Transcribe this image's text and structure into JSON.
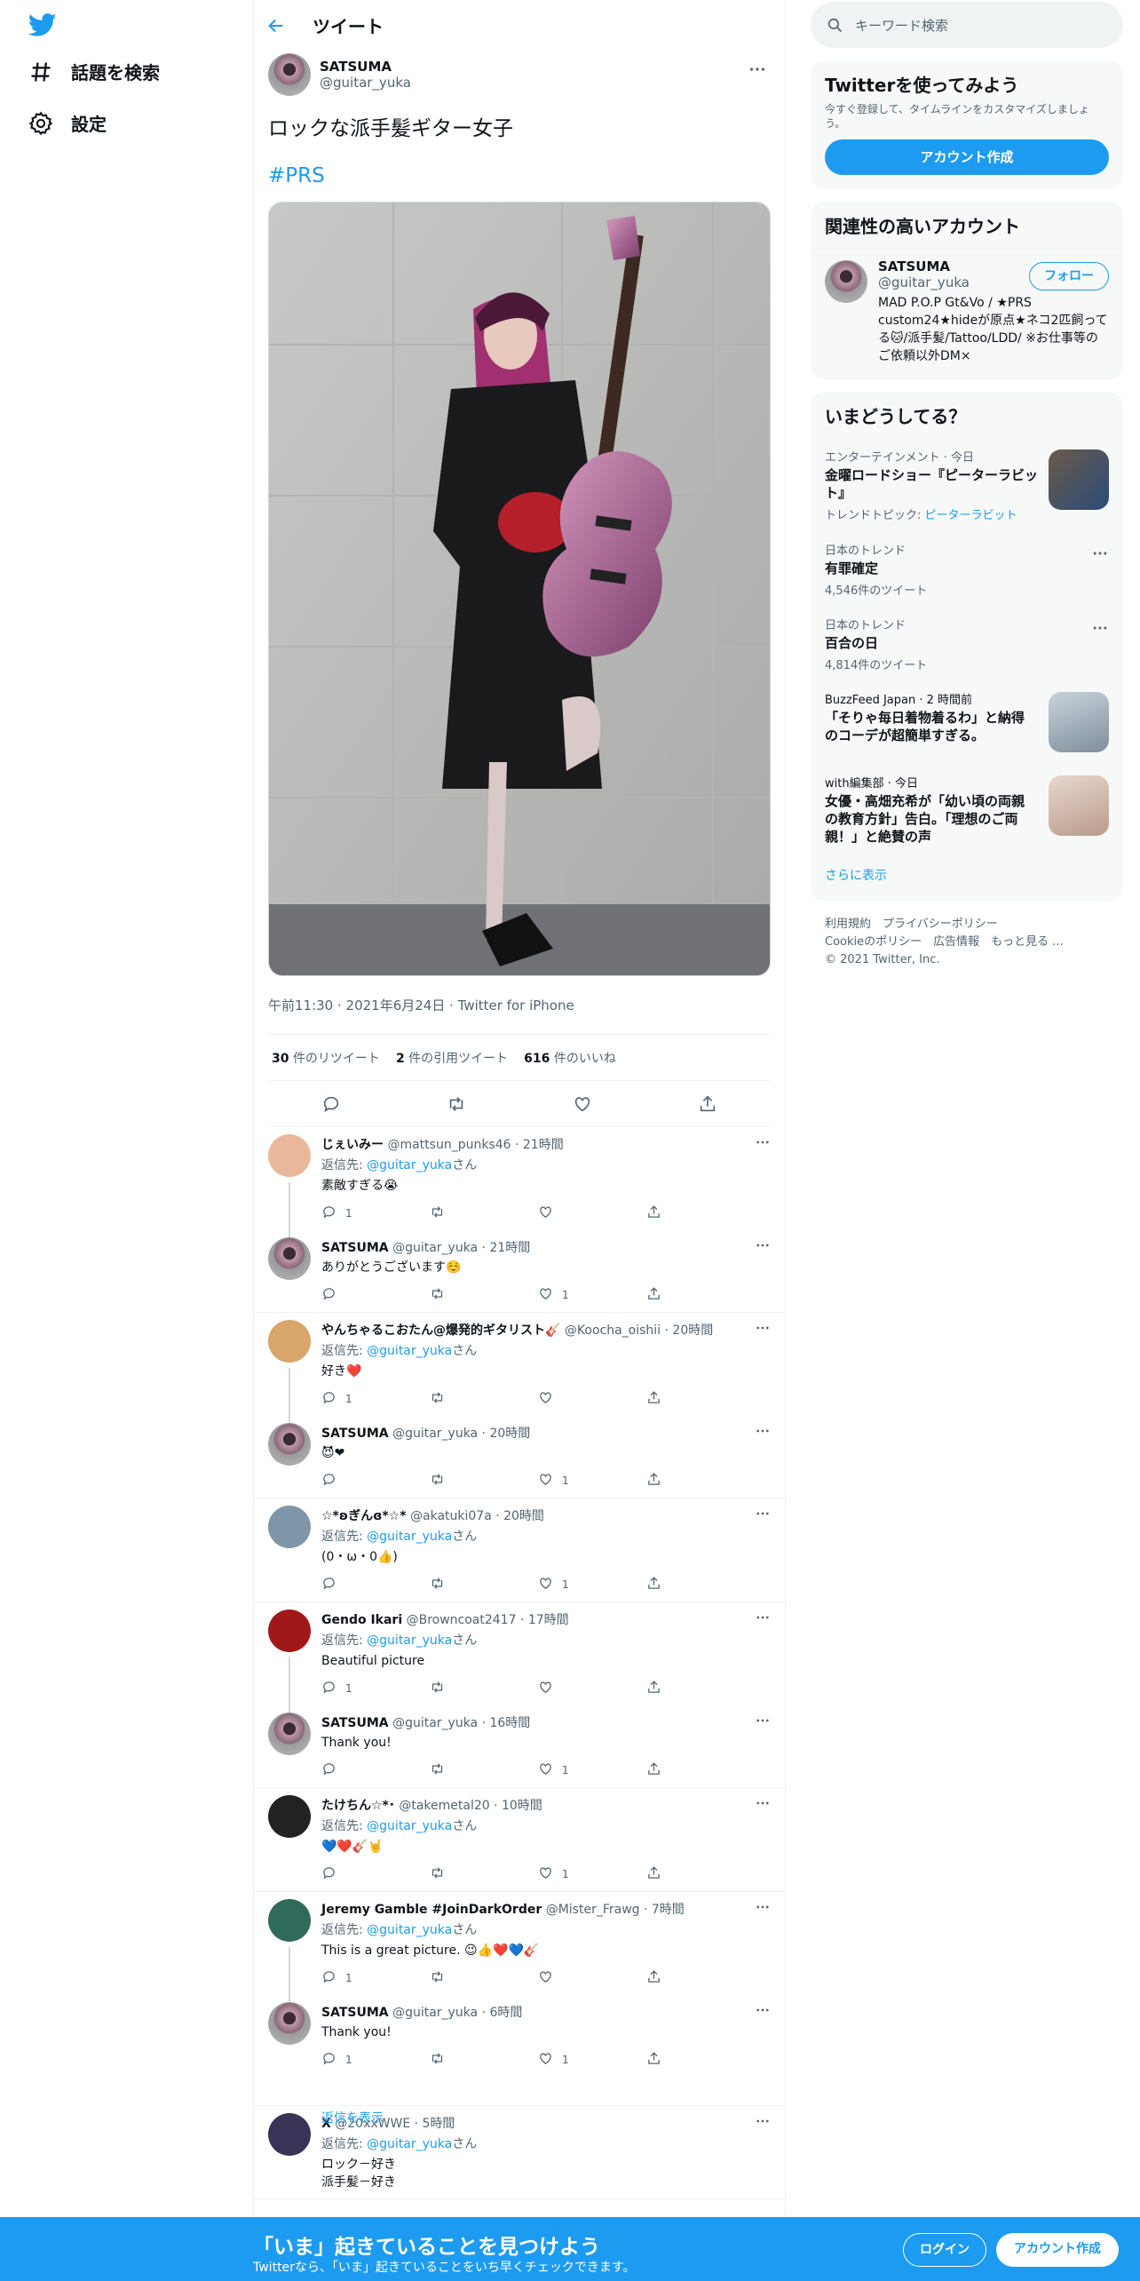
{
  "nav": {
    "explore": "話題を検索",
    "settings": "設定"
  },
  "header": {
    "title": "ツイート"
  },
  "tweet": {
    "name": "SATSUMA",
    "handle": "@guitar_yuka",
    "text": "ロックな派手髪ギター女子",
    "hashtag": "#PRS",
    "meta": "午前11:30 · 2021年6月24日 · Twitter for iPhone",
    "retweets": "30",
    "retweets_label": "件のリツイート",
    "quotes": "2",
    "quotes_label": "件の引用ツイート",
    "likes": "616",
    "likes_label": "件のいいね"
  },
  "replies": [
    {
      "name": "じぇいみー",
      "handle": "@mattsun_punks46 · 21時間",
      "to": "@guitar_yuka",
      "text": "素敵すぎる😭",
      "reply_count": "1",
      "retweet_count": "",
      "like_count": ""
    },
    {
      "name": "SATSUMA",
      "handle": "@guitar_yuka · 21時間",
      "to": "",
      "text": "ありがとうございます☺️",
      "reply_count": "",
      "retweet_count": "",
      "like_count": "1"
    },
    {
      "name": "やんちゃるこおたん@爆発的ギタリスト🎸",
      "handle": "@Koocha_oishii · 20時間",
      "to": "@guitar_yuka",
      "text": "好き❤️",
      "reply_count": "1",
      "retweet_count": "",
      "like_count": ""
    },
    {
      "name": "SATSUMA",
      "handle": "@guitar_yuka · 20時間",
      "to": "",
      "text": "😈❤",
      "reply_count": "",
      "retweet_count": "",
      "like_count": "1"
    },
    {
      "name": "☆*ʚぎんɞ*☆*",
      "handle": "@akatuki07a · 20時間",
      "to": "@guitar_yuka",
      "text": "(0・ω・0👍)",
      "reply_count": "",
      "retweet_count": "",
      "like_count": "1"
    },
    {
      "name": "Gendo Ikari",
      "handle": "@Browncoat2417 · 17時間",
      "to": "@guitar_yuka",
      "text": "Beautiful picture",
      "reply_count": "1",
      "retweet_count": "",
      "like_count": ""
    },
    {
      "name": "SATSUMA",
      "handle": "@guitar_yuka · 16時間",
      "to": "",
      "text": "Thank you!",
      "reply_count": "",
      "retweet_count": "",
      "like_count": "1"
    },
    {
      "name": "たけちん☆*･",
      "handle": "@takemetal20 · 10時間",
      "to": "@guitar_yuka",
      "text": "💙❤️🎸🤘",
      "reply_count": "",
      "retweet_count": "",
      "like_count": "1"
    },
    {
      "name": "Jeremy Gamble #JoinDarkOrder",
      "handle": "@Mister_Frawg · 7時間",
      "to": "@guitar_yuka",
      "text": "This is a great picture. 😉👍❤️💙🎸",
      "reply_count": "1",
      "retweet_count": "",
      "like_count": ""
    },
    {
      "name": "SATSUMA",
      "handle": "@guitar_yuka · 6時間",
      "to": "",
      "text": "Thank you!",
      "reply_count": "1",
      "retweet_count": "",
      "like_count": "1"
    },
    {
      "name": "X",
      "handle": "@20xxWWE · 5時間",
      "to": "@guitar_yuka",
      "text": "ロック－好き\n派手髪－好き",
      "reply_count": "",
      "retweet_count": "",
      "like_count": ""
    }
  ],
  "common": {
    "reply_to_prefix": "返信先: ",
    "reply_to_suffix": "さん",
    "show_replies": "返信を表示"
  },
  "sidebar": {
    "search_placeholder": "キーワード検索",
    "signup_title": "Twitterを使ってみよう",
    "signup_desc": "今すぐ登録して、タイムラインをカスタマイズしましょう。",
    "signup_button": "アカウント作成",
    "related_title": "関連性の高いアカウント",
    "related_name": "SATSUMA",
    "related_handle": "@guitar_yuka",
    "follow": "フォロー",
    "related_bio": "MAD P.O.P Gt&Vo / ★PRS custom24★hideが原点★ネコ2匹飼ってる🐱/派手髪/Tattoo/LDD/ ※お仕事等のご依頼以外DM×",
    "trends_title": "いまどうしてる？",
    "trends": [
      {
        "cat": "エンターテインメント · 今日",
        "name": "金曜ロードショー『ピーターラビット』",
        "sub_prefix": "トレンドトピック: ",
        "sub_link": "ピーターラビット"
      },
      {
        "cat": "日本のトレンド",
        "name": "有罪確定",
        "sub": "4,546件のツイート"
      },
      {
        "cat": "日本のトレンド",
        "name": "百合の日",
        "sub": "4,814件のツイート"
      },
      {
        "cat": "BuzzFeed Japan · 2 時間前",
        "name": "「そりゃ毎日着物着るわ」と納得のコーデが超簡単すぎる。"
      },
      {
        "cat": "with編集部 · 今日",
        "name": "女優・高畑充希が「幼い頃の両親の教育方針」告白。「理想のご両親！」と絶賛の声"
      }
    ],
    "show_more": "さらに表示",
    "footer1": "利用規約　プライバシーポリシー",
    "footer2": "Cookieのポリシー　広告情報　もっと見る ...",
    "footer3": "© 2021 Twitter, Inc."
  },
  "banner": {
    "title": "「いま」起きていることを見つけよう",
    "subtitle": "Twitterなら、「いま」起きていることをいち早くチェックできます。",
    "login": "ログイン",
    "signup": "アカウント作成"
  }
}
